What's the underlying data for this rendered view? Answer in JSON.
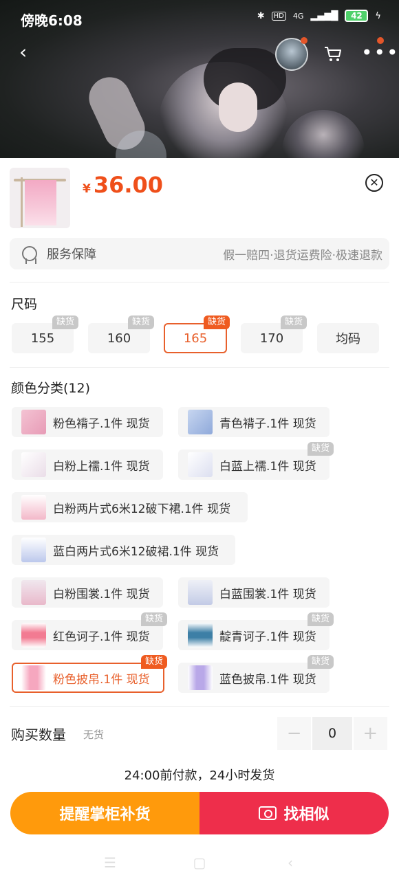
{
  "status": {
    "time": "傍晚6:08",
    "network": "4G",
    "hd": "HD",
    "battery": "42"
  },
  "nav": {
    "back_icon": "chevron-left-icon",
    "cart_icon": "cart-icon",
    "more_icon": "more-icon"
  },
  "product": {
    "currency": "¥",
    "price": "36.00"
  },
  "service": {
    "label": "服务保障",
    "desc": "假一赔四·退货运费险·极速退款"
  },
  "size": {
    "title": "尺码",
    "options": [
      {
        "label": "155",
        "tag": "缺货"
      },
      {
        "label": "160",
        "tag": "缺货"
      },
      {
        "label": "165",
        "tag": "缺货",
        "selected": true
      },
      {
        "label": "170",
        "tag": "缺货"
      },
      {
        "label": "均码",
        "tag": ""
      }
    ]
  },
  "color": {
    "title": "颜色分类(12)",
    "options": [
      {
        "label": "粉色褙子.1件 现货",
        "tag": ""
      },
      {
        "label": "青色褙子.1件 现货",
        "tag": ""
      },
      {
        "label": "白粉上襦.1件 现货",
        "tag": ""
      },
      {
        "label": "白蓝上襦.1件 现货",
        "tag": "缺货"
      },
      {
        "label": "白粉两片式6米12破下裙.1件 现货",
        "tag": ""
      },
      {
        "label": "蓝白两片式6米12破裙.1件 现货",
        "tag": ""
      },
      {
        "label": "白粉围裳.1件 现货",
        "tag": ""
      },
      {
        "label": "白蓝围裳.1件 现货",
        "tag": ""
      },
      {
        "label": "红色诃子.1件 现货",
        "tag": "缺货"
      },
      {
        "label": "靛青诃子.1件 现货",
        "tag": "缺货"
      },
      {
        "label": "粉色披帛.1件 现货",
        "tag": "缺货",
        "selected": true
      },
      {
        "label": "蓝色披帛.1件 现货",
        "tag": "缺货"
      }
    ]
  },
  "quantity": {
    "label": "购买数量",
    "stock": "无货",
    "minus": "−",
    "value": "0",
    "plus": "+"
  },
  "shipping_note": "24:00前付款，24小时发货",
  "actions": {
    "remind": "提醒掌柜补货",
    "similar": "找相似"
  },
  "colors": {
    "accent": "#ef4f1a",
    "orange": "#ff9a0c",
    "red": "#ee2e4b"
  }
}
